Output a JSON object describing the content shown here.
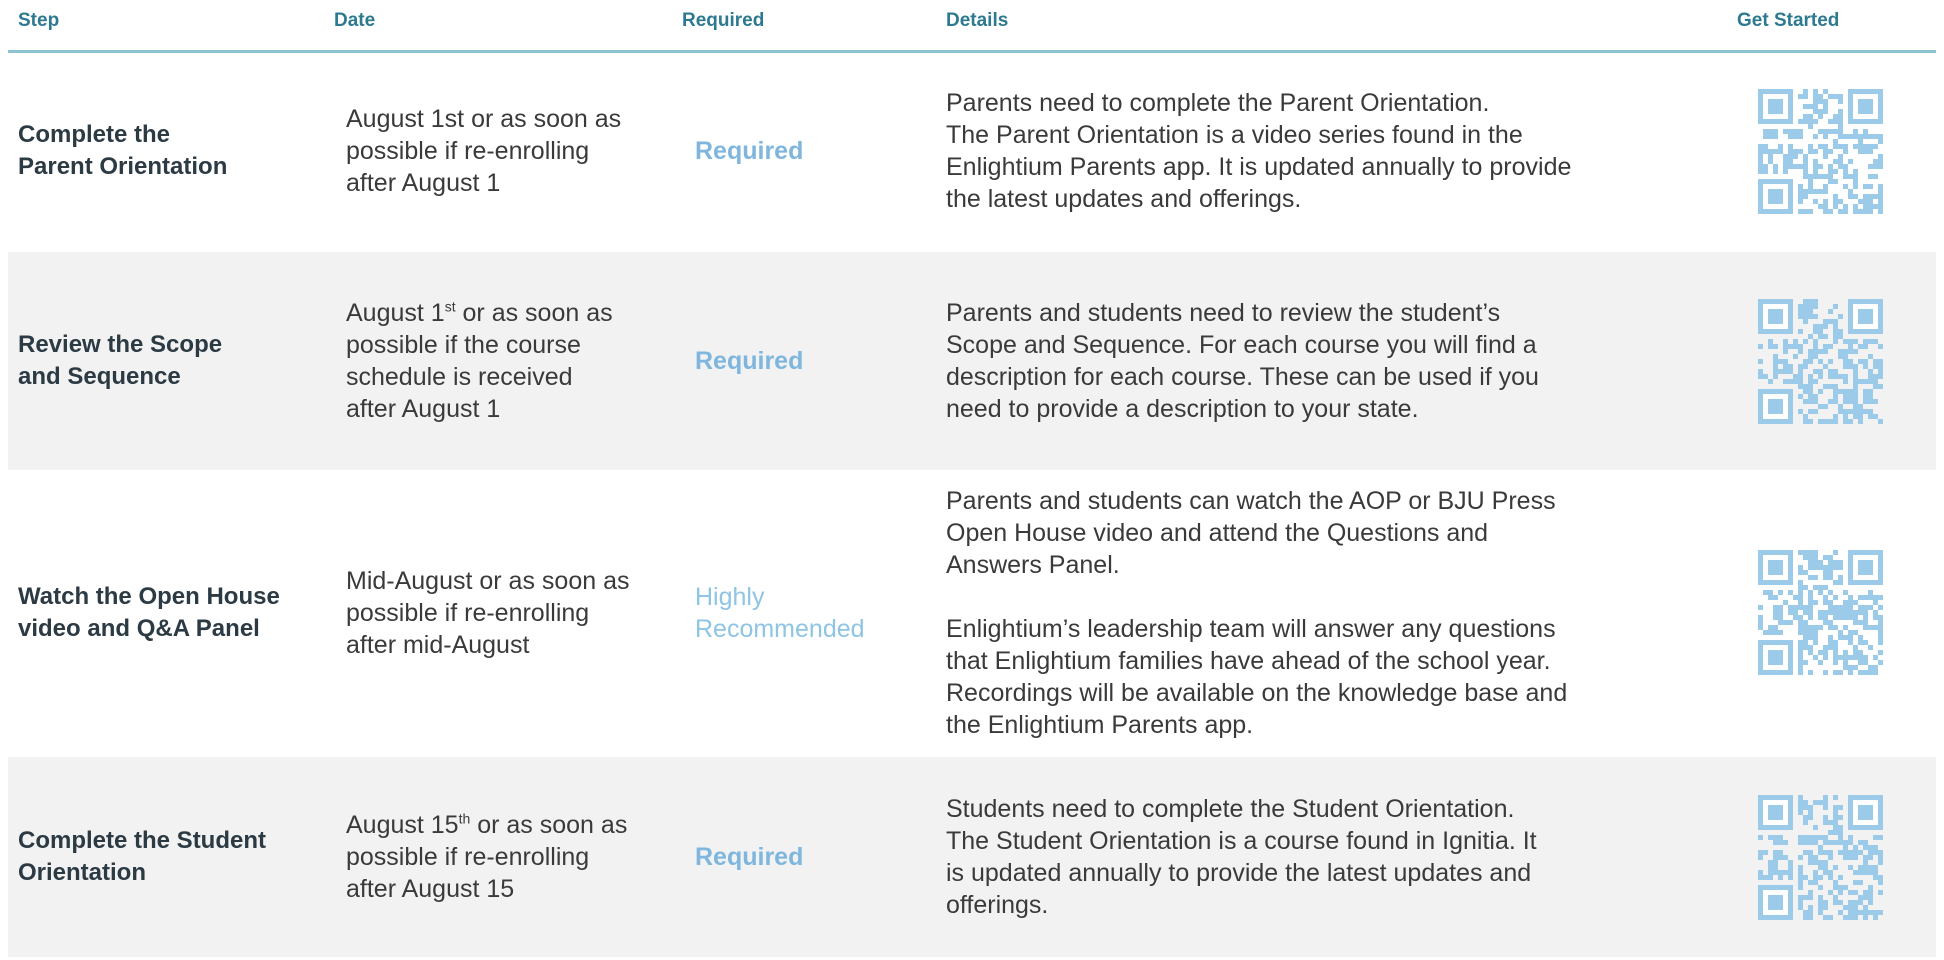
{
  "headers": {
    "step": "Step",
    "date": "Date",
    "required": "Required",
    "details": "Details",
    "get_started": "Get Started"
  },
  "rows": [
    {
      "step": [
        "Complete the",
        "Parent Orientation"
      ],
      "date_lines": [
        {
          "text": "August 1st or as soon as"
        },
        {
          "text": "possible if re-enrolling"
        },
        {
          "text": "after August 1"
        }
      ],
      "required": [
        "Required"
      ],
      "required_style": "bold",
      "details": [
        [
          "Parents need to complete the Parent Orientation.",
          "The Parent Orientation is a video series found in the",
          "Enlightium Parents app. It is updated annually to provide",
          "the latest updates and offerings."
        ]
      ],
      "qr_icon": "qr-code-icon"
    },
    {
      "step": [
        "Review the Scope",
        "and Sequence"
      ],
      "date_lines": [
        {
          "text": "August 1",
          "sup": "st",
          "after": " or as soon as"
        },
        {
          "text": "possible if the course"
        },
        {
          "text": "schedule is received"
        },
        {
          "text": "after August 1"
        }
      ],
      "required": [
        "Required"
      ],
      "required_style": "bold",
      "details": [
        [
          "Parents and students need to review the student’s",
          "Scope and Sequence. For each course you will find a",
          "description for each course. These can be used if you",
          "need to provide a description to your state."
        ]
      ],
      "qr_icon": "qr-code-icon"
    },
    {
      "step": [
        "Watch the Open House",
        "video and Q&A Panel"
      ],
      "date_lines": [
        {
          "text": "Mid-August or as soon as"
        },
        {
          "text": "possible if re-enrolling"
        },
        {
          "text": "after mid-August"
        }
      ],
      "required": [
        "Highly",
        "Recommended"
      ],
      "required_style": "light",
      "details": [
        [
          "Parents and students can watch the AOP or BJU Press",
          "Open House video and attend the Questions and",
          "Answers Panel."
        ],
        [
          "Enlightium’s leadership team will answer any questions",
          "that Enlightium families have ahead of the school year.",
          "Recordings will be available on the knowledge base and",
          "the Enlightium Parents app."
        ]
      ],
      "qr_icon": "qr-code-icon"
    },
    {
      "step": [
        "Complete the Student",
        "Orientation"
      ],
      "date_lines": [
        {
          "text": "August 15",
          "sup": "th",
          "after": " or as soon as"
        },
        {
          "text": "possible if re-enrolling"
        },
        {
          "text": "after August 15"
        }
      ],
      "required": [
        "Required"
      ],
      "required_style": "bold",
      "details": [
        [
          "Students need to complete the Student Orientation.",
          "The Student Orientation is a course found in Ignitia. It",
          "is updated annually to provide the latest updates and",
          "offerings."
        ]
      ],
      "qr_icon": "qr-code-icon"
    }
  ],
  "colors": {
    "header_text": "#2d7a90",
    "header_rule": "#8dc3d3",
    "required_text": "#7fb6de",
    "qr_color": "#9ccbe9",
    "shaded_row": "#f2f2f2"
  }
}
